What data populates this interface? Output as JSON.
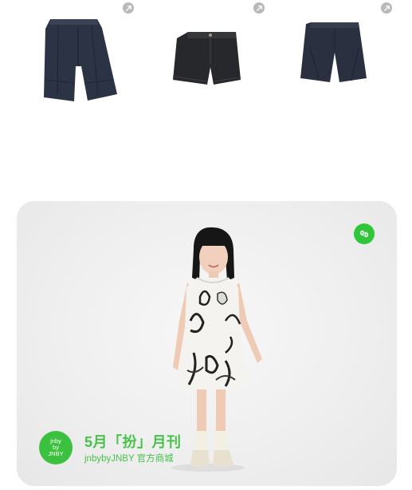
{
  "products": [
    {
      "icon": "mini-program-link-icon",
      "item": "navy-cropped-wide-shorts"
    },
    {
      "icon": "mini-program-link-icon",
      "item": "dark-denim-shorts"
    },
    {
      "icon": "mini-program-link-icon",
      "item": "navy-wide-shorts"
    }
  ],
  "banner": {
    "corner_icon": "mini-program-icon",
    "logo_lines": [
      "jnby",
      "by",
      "JNBY"
    ],
    "title": "5月「扮」月刊",
    "store_name": "jnbybyJNBY 官方商城",
    "accent_color": "#3cc13f"
  }
}
